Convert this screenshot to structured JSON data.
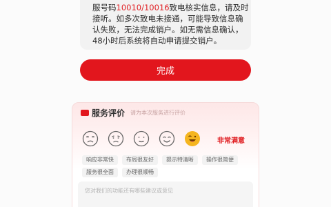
{
  "notice": {
    "line1_a": "服号码",
    "line1_hl": "10010/10016",
    "line1_b": "致电核实信息，请及时",
    "line2": "接听。如多次致电未接通，可能导致信息确",
    "line3": "认失败，无法完成销户。如无需信息确认，",
    "line4": "48小时后系统将自动申请提交销户。"
  },
  "done_button": "完成",
  "rating": {
    "title": "服务评价",
    "subtitle": "请为本次服务进行评价",
    "faces": [
      "very-unsatisfied-face",
      "unsatisfied-face",
      "neutral-face",
      "satisfied-face",
      "very-satisfied-face"
    ],
    "selected_label": "非常满意",
    "tags_row1": [
      "响应非常快",
      "布局很友好",
      "提示特清晰",
      "操作很简便"
    ],
    "tags_row2": [
      "服务很全面",
      "办理很顺畅"
    ],
    "placeholder": "您对我们的功能还有哪些建议或意见"
  },
  "colors": {
    "accent": "#e2161d",
    "emoji": "#f5b51f"
  }
}
